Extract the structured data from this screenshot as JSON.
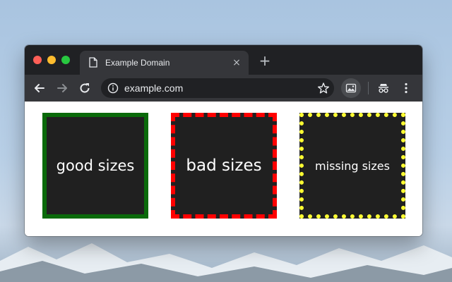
{
  "browser": {
    "tab_title": "Example Domain",
    "tab_close_glyph": "×",
    "new_tab_glyph": "+",
    "url": "example.com"
  },
  "page": {
    "boxes": [
      {
        "label": "good sizes",
        "border_color": "#0a6a0a",
        "border_style": "solid"
      },
      {
        "label": "bad sizes",
        "border_color": "#ff0000",
        "border_style": "dashed"
      },
      {
        "label": "missing sizes",
        "border_color": "#ffff33",
        "border_style": "dotted"
      }
    ]
  },
  "colors": {
    "titlebar": "#202124",
    "toolbar": "#35363a",
    "box_fill": "#202020"
  },
  "icons": [
    "page-icon",
    "close-icon",
    "plus-icon",
    "back-arrow-icon",
    "forward-arrow-icon",
    "reload-icon",
    "info-icon",
    "star-icon",
    "image-extension-icon",
    "incognito-icon",
    "more-menu-icon"
  ]
}
